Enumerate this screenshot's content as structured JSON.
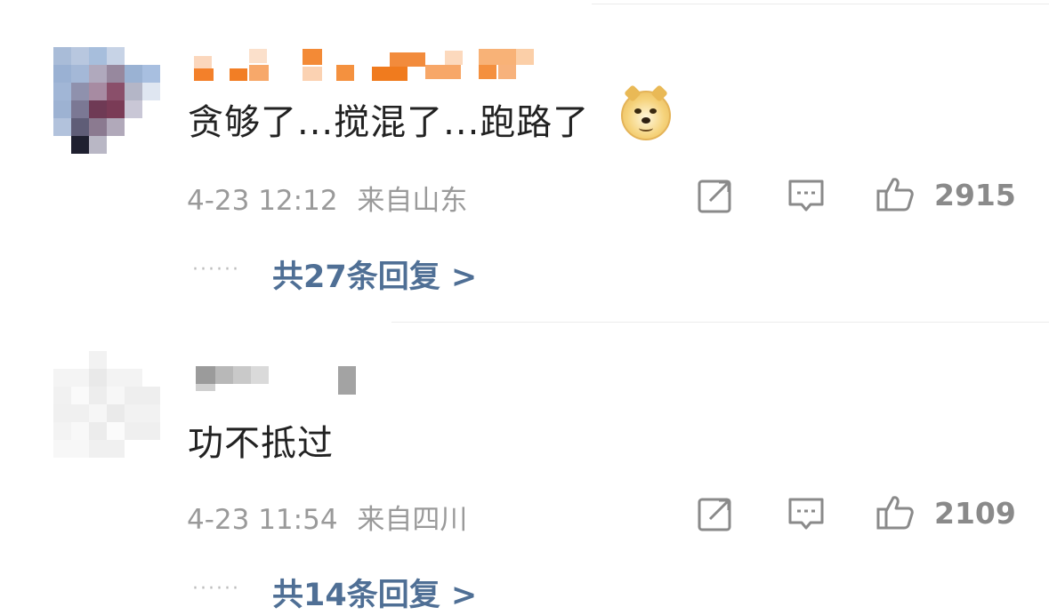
{
  "comments": [
    {
      "text": "贪够了...搅混了...跑路了",
      "emoji": "doge-icon",
      "timestamp": "4-23 12:12",
      "location": "来自山东",
      "likes": "2915",
      "replies_label": "共27条回复 >",
      "dots": "······"
    },
    {
      "text": "功不抵过",
      "timestamp": "4-23 11:54",
      "location": "来自四川",
      "likes": "2109",
      "replies_label": "共14条回复 >",
      "dots": "······"
    }
  ],
  "colors": {
    "text": "#222222",
    "meta": "#9a9a9a",
    "link": "#4f6f95",
    "name_mask_orange": "#f07b1e"
  }
}
